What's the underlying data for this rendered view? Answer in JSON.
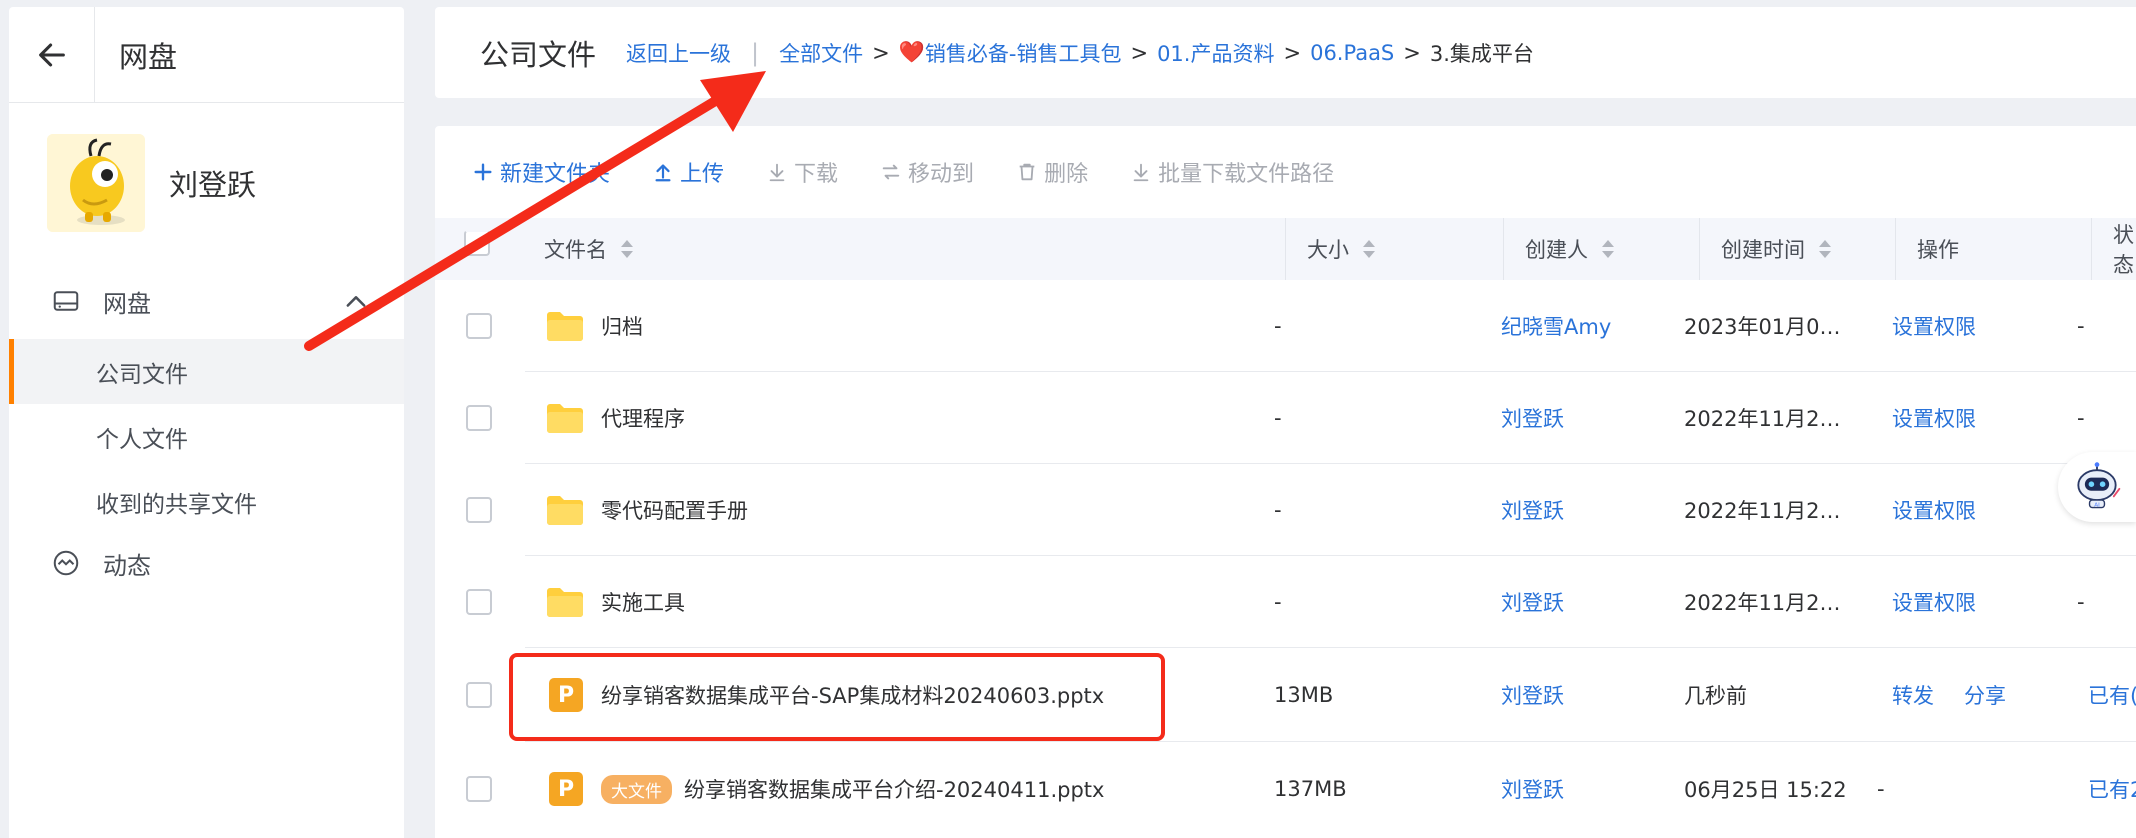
{
  "sidebar": {
    "title": "网盘",
    "user_name": "刘登跃",
    "group_label": "网盘",
    "items": [
      {
        "label": "公司文件",
        "active": true
      },
      {
        "label": "个人文件",
        "active": false
      },
      {
        "label": "收到的共享文件",
        "active": false
      }
    ],
    "activity_label": "动态"
  },
  "breadcrumb": {
    "page_title": "公司文件",
    "back_link": "返回上一级",
    "separator": "|",
    "path": [
      "全部文件",
      "销售必备-销售工具包",
      "01.产品资料",
      "06.PaaS"
    ],
    "current": "3.集成平台",
    "heart": "❤️",
    "gt": ">"
  },
  "toolbar": {
    "new_folder": "新建文件夹",
    "upload": "上传",
    "download": "下载",
    "move_to": "移动到",
    "delete": "删除",
    "batch_download": "批量下载文件路径"
  },
  "table": {
    "headers": {
      "name": "文件名",
      "size": "大小",
      "creator": "创建人",
      "created": "创建时间",
      "ops": "操作",
      "status": "状态"
    },
    "rows": [
      {
        "type": "folder",
        "name": "归档",
        "size": "-",
        "creator": "纪晓雪Amy",
        "created": "2023年01月0…",
        "ops": [
          "设置权限"
        ],
        "status": "-"
      },
      {
        "type": "folder",
        "name": "代理程序",
        "size": "-",
        "creator": "刘登跃",
        "created": "2022年11月2…",
        "ops": [
          "设置权限"
        ],
        "status": "-"
      },
      {
        "type": "folder",
        "name": "零代码配置手册",
        "size": "-",
        "creator": "刘登跃",
        "created": "2022年11月2…",
        "ops": [
          "设置权限"
        ],
        "status": "-"
      },
      {
        "type": "folder",
        "name": "实施工具",
        "size": "-",
        "creator": "刘登跃",
        "created": "2022年11月2…",
        "ops": [
          "设置权限"
        ],
        "status": "-"
      },
      {
        "type": "ppt",
        "name": "纷享销客数据集成平台-SAP集成材料20240603.pptx",
        "size": "13MB",
        "creator": "刘登跃",
        "created": "几秒前",
        "ops": [
          "转发",
          "分享"
        ],
        "status": "已有("
      },
      {
        "type": "ppt",
        "badge": "大文件",
        "name": "纷享销客数据集成平台介绍-20240411.pptx",
        "size": "137MB",
        "creator": "刘登跃",
        "created": "06月25日 15:22",
        "ops": [
          "-"
        ],
        "status": "已有2"
      }
    ]
  },
  "file_icon_letter": "P",
  "robot_label": "AI",
  "colors": {
    "accent": "#2a73d9",
    "active_bar": "#ff8000",
    "annotation": "#f42b1a",
    "folder": "#ffcf3d",
    "ppt": "#f5a623"
  }
}
